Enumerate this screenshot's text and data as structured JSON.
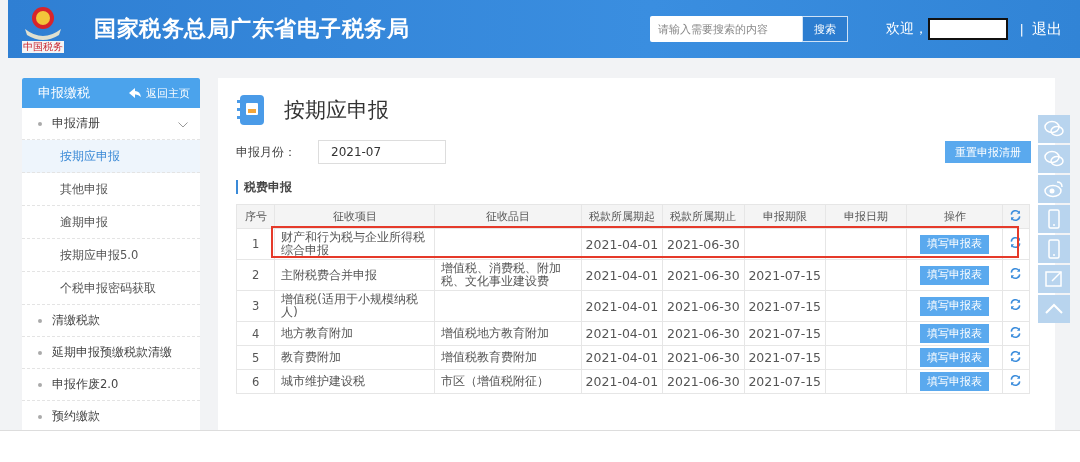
{
  "header": {
    "title": "国家税务总局广东省电子税务局",
    "logo_caption": "中国税务",
    "search": {
      "placeholder": "请输入需要搜索的内容",
      "button": "搜索"
    },
    "welcome": "欢迎，",
    "separator": "|",
    "logout": "退出"
  },
  "sidebar": {
    "title": "申报缴税",
    "back": "返回主页",
    "items": [
      {
        "label": "申报清册",
        "expanded": true,
        "children": [
          {
            "label": "按期应申报",
            "selected": true
          },
          {
            "label": "其他申报",
            "selected": false
          },
          {
            "label": "逾期申报",
            "selected": false
          },
          {
            "label": "按期应申报5.0",
            "selected": false
          },
          {
            "label": "个税申报密码获取",
            "selected": false
          }
        ]
      },
      {
        "label": "清缴税款",
        "expanded": false
      },
      {
        "label": "延期申报预缴税款清缴",
        "expanded": false
      },
      {
        "label": "申报作废2.0",
        "expanded": false
      },
      {
        "label": "预约缴款",
        "expanded": false
      }
    ]
  },
  "main": {
    "title": "按期应申报",
    "month_label": "申报月份：",
    "month_value": "2021-07",
    "reset_button": "重置申报清册",
    "section": "税费申报",
    "table": {
      "columns": [
        "序号",
        "征收项目",
        "征收品目",
        "税款所属期起",
        "税款所属期止",
        "申报期限",
        "申报日期",
        "操作"
      ],
      "rows": [
        {
          "cells": [
            "1",
            "财产和行为税与企业所得税综合申报",
            "",
            "2021-04-01",
            "2021-06-30",
            "",
            ""
          ],
          "action": "填写申报表",
          "highlighted": true
        },
        {
          "cells": [
            "2",
            "主附税费合并申报",
            "增值税、消费税、附加税、文化事业建设费",
            "2021-04-01",
            "2021-06-30",
            "2021-07-15",
            ""
          ],
          "action": "填写申报表",
          "highlighted": false
        },
        {
          "cells": [
            "3",
            "增值税(适用于小规模纳税人)",
            "",
            "2021-04-01",
            "2021-06-30",
            "2021-07-15",
            ""
          ],
          "action": "填写申报表",
          "highlighted": false
        },
        {
          "cells": [
            "4",
            "地方教育附加",
            "增值税地方教育附加",
            "2021-04-01",
            "2021-06-30",
            "2021-07-15",
            ""
          ],
          "action": "填写申报表",
          "highlighted": false
        },
        {
          "cells": [
            "5",
            "教育费附加",
            "增值税教育费附加",
            "2021-04-01",
            "2021-06-30",
            "2021-07-15",
            ""
          ],
          "action": "填写申报表",
          "highlighted": false
        },
        {
          "cells": [
            "6",
            "城市维护建设税",
            "市区（增值税附征）",
            "2021-04-01",
            "2021-06-30",
            "2021-07-15",
            ""
          ],
          "action": "填写申报表",
          "highlighted": false
        }
      ]
    }
  }
}
